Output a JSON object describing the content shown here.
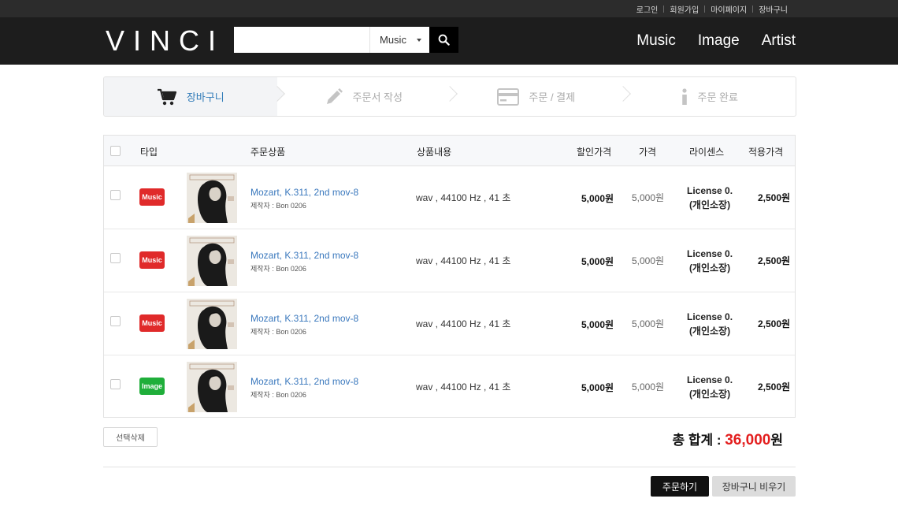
{
  "util_links": [
    "로그인",
    "회원가입",
    "마이페이지",
    "장바구니"
  ],
  "header": {
    "logo": "VINCI",
    "search": {
      "placeholder": "",
      "category": "Music"
    },
    "nav": [
      "Music",
      "Image",
      "Artist"
    ]
  },
  "steps": [
    {
      "label": "장바구니",
      "icon": "cart-icon",
      "active": true
    },
    {
      "label": "주문서 작성",
      "icon": "pencil-icon",
      "active": false
    },
    {
      "label": "주문 / 결제",
      "icon": "credit-card-icon",
      "active": false
    },
    {
      "label": "주문 완료",
      "icon": "info-icon",
      "active": false
    }
  ],
  "table": {
    "headers": {
      "type": "타입",
      "product": "주문상품",
      "detail": "상품내용",
      "discount_price": "할인가격",
      "price": "가격",
      "license": "라이센스",
      "applied_price": "적용가격"
    },
    "rows": [
      {
        "type": "Music",
        "type_color": "#e02a2a",
        "title": "Mozart, K.311, 2nd mov-8",
        "maker": "제작자 : Bon 0206",
        "detail": "wav , 44100 Hz , 41 초",
        "discount_price": "5,000원",
        "price": "5,000원",
        "license_line1": "License 0.",
        "license_line2": "(개인소장)",
        "applied_price": "2,500원"
      },
      {
        "type": "Music",
        "type_color": "#e02a2a",
        "title": "Mozart, K.311, 2nd mov-8",
        "maker": "제작자 : Bon 0206",
        "detail": "wav , 44100 Hz , 41 초",
        "discount_price": "5,000원",
        "price": "5,000원",
        "license_line1": "License 0.",
        "license_line2": "(개인소장)",
        "applied_price": "2,500원"
      },
      {
        "type": "Music",
        "type_color": "#e02a2a",
        "title": "Mozart, K.311, 2nd mov-8",
        "maker": "제작자 : Bon 0206",
        "detail": "wav , 44100 Hz , 41 초",
        "discount_price": "5,000원",
        "price": "5,000원",
        "license_line1": "License 0.",
        "license_line2": "(개인소장)",
        "applied_price": "2,500원"
      },
      {
        "type": "Image",
        "type_color": "#1fae3a",
        "title": "Mozart, K.311, 2nd mov-8",
        "maker": "제작자 : Bon 0206",
        "detail": "wav , 44100 Hz , 41 초",
        "discount_price": "5,000원",
        "price": "5,000원",
        "license_line1": "License 0.",
        "license_line2": "(개인소장)",
        "applied_price": "2,500원"
      }
    ]
  },
  "footer": {
    "delete_selected": "선택삭제",
    "total_label": "총 합계 : ",
    "total_amount": "36,000",
    "total_unit": "원",
    "order_button": "주문하기",
    "empty_cart_button": "장바구니 비우기"
  },
  "colors": {
    "accent": "#2f7ab8",
    "total_red": "#e31e1e",
    "header_bg": "#1d1d1d"
  }
}
